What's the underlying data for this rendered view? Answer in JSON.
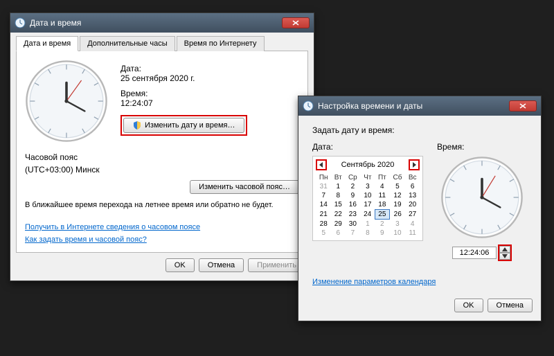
{
  "colors": {
    "highlight": "#d80000",
    "link": "#0066cc"
  },
  "win1": {
    "title": "Дата и время",
    "tabs": {
      "t0": "Дата и время",
      "t1": "Дополнительные часы",
      "t2": "Время по Интернету"
    },
    "date_label": "Дата:",
    "date_value": "25 сентября 2020 г.",
    "time_label": "Время:",
    "time_value": "12:24:07",
    "change_dt_btn": "Изменить дату и время…",
    "tz_label": "Часовой пояс",
    "tz_value": "(UTC+03:00) Минск",
    "change_tz_btn": "Изменить часовой пояс…",
    "dst_note": "В ближайшее время перехода на летнее время или обратно не будет.",
    "link_tz_info": "Получить в Интернете сведения о часовом поясе",
    "link_howto": "Как задать время и часовой пояс?",
    "buttons": {
      "ok": "OK",
      "cancel": "Отмена",
      "apply": "Применить"
    }
  },
  "win2": {
    "title": "Настройка времени и даты",
    "prompt": "Задать дату и время:",
    "date_label": "Дата:",
    "time_label": "Время:",
    "calendar": {
      "month": "Сентябрь 2020",
      "dow": [
        "Пн",
        "Вт",
        "Ср",
        "Чт",
        "Пт",
        "Сб",
        "Вс"
      ],
      "weeks": [
        [
          {
            "d": 31,
            "dim": true
          },
          {
            "d": 1
          },
          {
            "d": 2
          },
          {
            "d": 3
          },
          {
            "d": 4
          },
          {
            "d": 5
          },
          {
            "d": 6
          }
        ],
        [
          {
            "d": 7
          },
          {
            "d": 8
          },
          {
            "d": 9
          },
          {
            "d": 10
          },
          {
            "d": 11
          },
          {
            "d": 12
          },
          {
            "d": 13
          }
        ],
        [
          {
            "d": 14
          },
          {
            "d": 15
          },
          {
            "d": 16
          },
          {
            "d": 17
          },
          {
            "d": 18
          },
          {
            "d": 19
          },
          {
            "d": 20
          }
        ],
        [
          {
            "d": 21
          },
          {
            "d": 22
          },
          {
            "d": 23
          },
          {
            "d": 24
          },
          {
            "d": 25,
            "today": true
          },
          {
            "d": 26
          },
          {
            "d": 27
          }
        ],
        [
          {
            "d": 28
          },
          {
            "d": 29
          },
          {
            "d": 30
          },
          {
            "d": 1,
            "dim": true
          },
          {
            "d": 2,
            "dim": true
          },
          {
            "d": 3,
            "dim": true
          },
          {
            "d": 4,
            "dim": true
          }
        ],
        [
          {
            "d": 5,
            "dim": true
          },
          {
            "d": 6,
            "dim": true
          },
          {
            "d": 7,
            "dim": true
          },
          {
            "d": 8,
            "dim": true
          },
          {
            "d": 9,
            "dim": true
          },
          {
            "d": 10,
            "dim": true
          },
          {
            "d": 11,
            "dim": true
          }
        ]
      ]
    },
    "time_value": "12:24:06",
    "link_cal": "Изменение параметров календаря",
    "buttons": {
      "ok": "OK",
      "cancel": "Отмена"
    }
  }
}
